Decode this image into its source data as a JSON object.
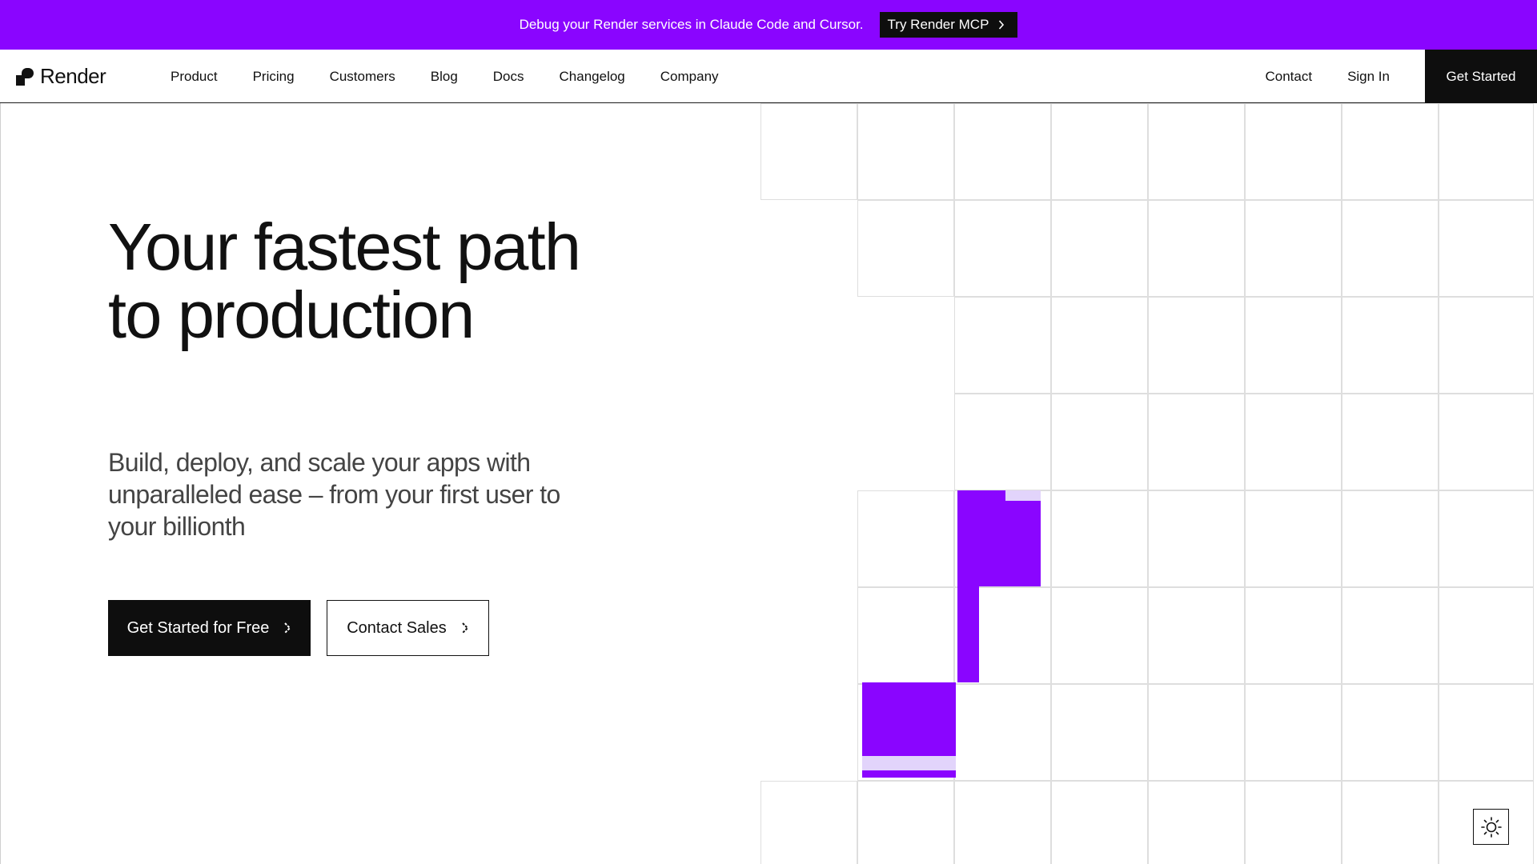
{
  "banner": {
    "text": "Debug your Render services in Claude Code and Cursor.",
    "button_label": "Try Render MCP",
    "background": "#8a05ff"
  },
  "nav": {
    "logo_text": "Render",
    "links": [
      "Product",
      "Pricing",
      "Customers",
      "Blog",
      "Docs",
      "Changelog",
      "Company"
    ],
    "right_links": [
      "Contact",
      "Sign In"
    ],
    "cta_label": "Get Started"
  },
  "hero": {
    "title": "Your fastest path to production",
    "subtitle": "Build, deploy, and scale your apps with unparalleled ease – from your first user to your billionth",
    "primary_button": "Get Started for Free",
    "secondary_button": "Contact Sales"
  },
  "colors": {
    "accent": "#8a05ff",
    "accent_light": "#e2d4fb",
    "dark": "#0e0e0e"
  },
  "icons": {
    "theme_toggle": "sun-icon",
    "chevron": "chevron-right-icon"
  }
}
